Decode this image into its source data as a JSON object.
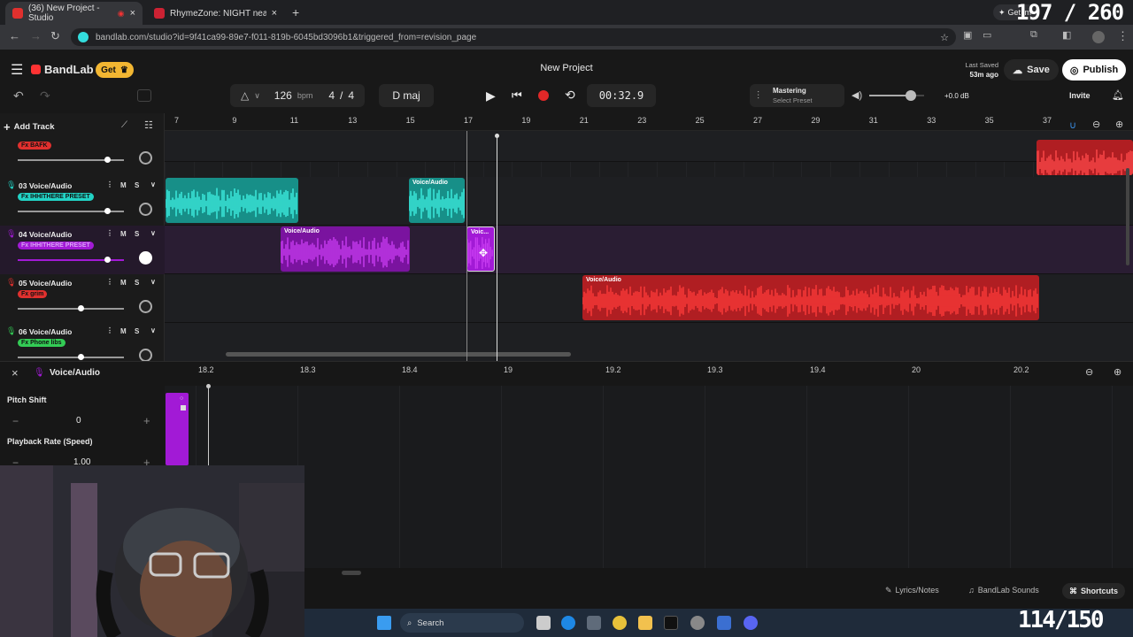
{
  "browser": {
    "tabs": [
      {
        "label": "(36) New Project - Studio",
        "active": true
      },
      {
        "label": "RhymeZone: NIGHT near rhyme",
        "active": false
      }
    ],
    "url": "bandlab.com/studio?id=9f41ca99-89e7-f011-819b-6045bd3096b1&triggered_from=revision_page",
    "get_label": "Get im"
  },
  "overlay": {
    "top_counter": "197 / 260",
    "bottom_counter": "114/150"
  },
  "app": {
    "brand": "BandLab",
    "get_button": "Get",
    "project_title": "New Project",
    "last_saved_label": "Last Saved",
    "last_saved_time": "53m ago",
    "save_label": "Save",
    "publish_label": "Publish",
    "invite_label": "Invite"
  },
  "transport": {
    "tempo": "126",
    "tempo_unit": "bpm",
    "time_sig_num": "4",
    "time_sig_sep": "/",
    "time_sig_den": "4",
    "key": "D maj",
    "time": "00:32.9",
    "mastering_label": "Mastering",
    "mastering_preset": "Select Preset",
    "master_gain": "+0.0 dB",
    "master_volume": 0.75
  },
  "toolbar": {
    "add_track": "Add Track"
  },
  "ruler": {
    "bars": [
      "7",
      "9",
      "11",
      "13",
      "15",
      "17",
      "19",
      "21",
      "23",
      "25",
      "27",
      "29",
      "31",
      "33",
      "35",
      "37"
    ]
  },
  "tracks": [
    {
      "id": "02",
      "name": "Voice/Audio",
      "fx": "BAFK",
      "fx_color": "#e0302e",
      "volume": 0.85,
      "color": "#e0302e"
    },
    {
      "id": "03",
      "name": "03 Voice/Audio",
      "fx": "IHHITHERE PRESET",
      "fx_color": "#22d3c5",
      "volume": 0.85,
      "color": "#22d3c5"
    },
    {
      "id": "04",
      "name": "04 Voice/Audio",
      "fx": "IHHITHERE PRESET",
      "fx_color": "#a21ad6",
      "volume": 0.85,
      "color": "#a21ad6"
    },
    {
      "id": "05",
      "name": "05 Voice/Audio",
      "fx": "grim",
      "fx_color": "#e0302e",
      "volume": 0.6,
      "color": "#e0302e"
    },
    {
      "id": "06",
      "name": "06 Voice/Audio",
      "fx": "Phone libs",
      "fx_color": "#33cc55",
      "volume": 0.6,
      "color": "#33cc55"
    }
  ],
  "clips": {
    "label": "Voice/Audio",
    "short_label": "Voic..."
  },
  "editor": {
    "title": "Voice/Audio",
    "ticks": [
      "18.2",
      "18.3",
      "18.4",
      "19",
      "19.2",
      "19.3",
      "19.4",
      "20",
      "20.2"
    ],
    "pitch_shift_label": "Pitch Shift",
    "pitch_shift_value": "0",
    "playback_rate_label": "Playback Rate (Speed)",
    "playback_rate_value": "1.00"
  },
  "footer": {
    "lyrics": "Lyrics/Notes",
    "sounds": "BandLab Sounds",
    "shortcuts": "Shortcuts"
  },
  "taskbar": {
    "search": "Search"
  }
}
